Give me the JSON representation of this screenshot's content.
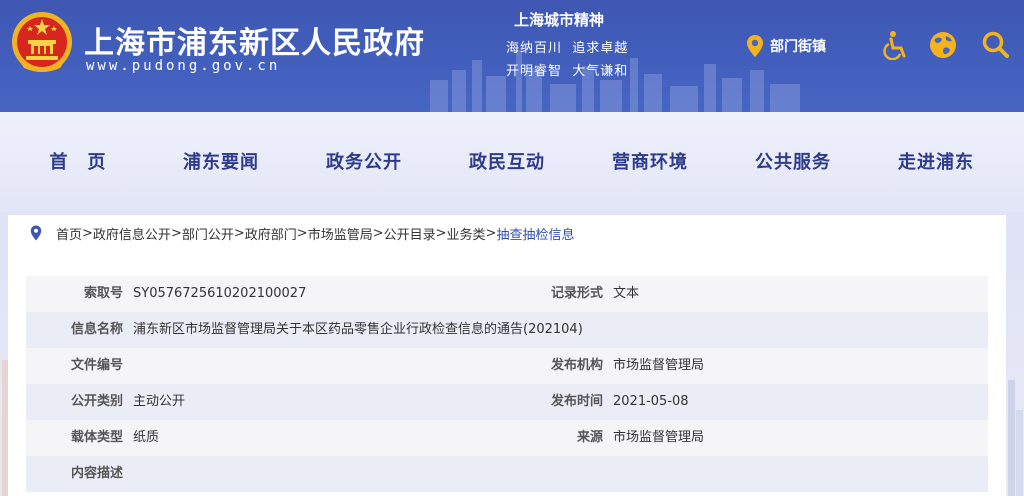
{
  "header": {
    "site_title": "上海市浦东新区人民政府",
    "site_url": "www.pudong.gov.cn",
    "spirit": {
      "title": "上海城市精神",
      "line1": "海纳百川  追求卓越",
      "line2": "开明睿智  大气谦和"
    },
    "street_link": "部门街镇",
    "icons": [
      "accessibility-icon",
      "globe-icon",
      "search-icon"
    ],
    "colors": {
      "header_bg": "#4765c4",
      "accent": "#f5b31a",
      "nav_text": "#2d3b8a"
    }
  },
  "nav": {
    "items": [
      {
        "label": "首　页"
      },
      {
        "label": "浦东要闻"
      },
      {
        "label": "政务公开"
      },
      {
        "label": "政民互动"
      },
      {
        "label": "营商环境"
      },
      {
        "label": "公共服务"
      },
      {
        "label": "走进浦东"
      }
    ]
  },
  "breadcrumb": {
    "items": [
      "首页",
      "政府信息公开",
      "部门公开",
      "政府部门 ",
      " 市场监管局",
      "公开目录",
      "业务类"
    ],
    "current": "抽查抽检信息"
  },
  "info": {
    "rows": [
      {
        "left_label": "索取号",
        "left_value": "SY0576725610202100027",
        "right_label": "记录形式",
        "right_value": "文本"
      },
      {
        "left_label": "信息名称",
        "left_value": "浦东新区市场监督管理局关于本区药品零售企业行政检查信息的通告(202104)",
        "right_label": "",
        "right_value": ""
      },
      {
        "left_label": "文件编号",
        "left_value": "",
        "right_label": "发布机构",
        "right_value": "市场监督管理局"
      },
      {
        "left_label": "公开类别",
        "left_value": "主动公开",
        "right_label": "发布时间",
        "right_value": "2021-05-08"
      },
      {
        "left_label": "载体类型",
        "left_value": "纸质",
        "right_label": "来源",
        "right_value": "市场监督管理局"
      },
      {
        "left_label": "内容描述",
        "left_value": "",
        "right_label": "",
        "right_value": ""
      }
    ]
  }
}
